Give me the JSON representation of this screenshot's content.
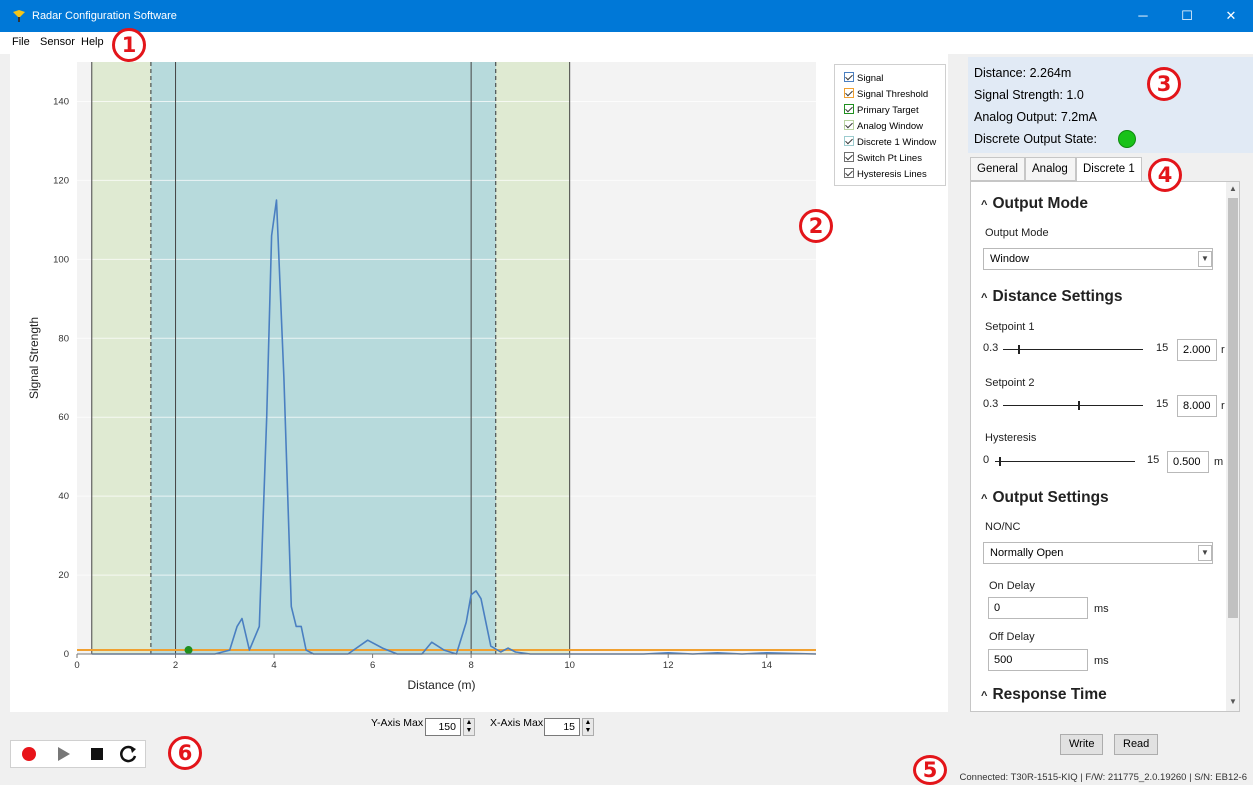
{
  "window": {
    "title": "Radar Configuration Software",
    "minimize": "─",
    "maximize": "☐",
    "close": "✕"
  },
  "menu": {
    "file": "File",
    "sensor": "Sensor",
    "help": "Help"
  },
  "badges": {
    "b1": "1",
    "b2": "2",
    "b3": "3",
    "b4": "4",
    "b5": "5",
    "b6": "6"
  },
  "legend": {
    "items": [
      "Signal",
      "Signal Threshold",
      "Primary Target",
      "Analog Window",
      "Discrete 1 Window",
      "Switch Pt Lines",
      "Hysteresis Lines"
    ]
  },
  "readout": {
    "distance": "Distance: 2.264m",
    "signal_strength": "Signal Strength:  1.0",
    "analog_output": "Analog Output:  7.2mA",
    "discrete_state_label": "Discrete Output State:"
  },
  "tabs": [
    "General",
    "Analog",
    "Discrete 1"
  ],
  "panel": {
    "output_mode_header": "Output Mode",
    "output_mode_label": "Output Mode",
    "output_mode_value": "Window",
    "distance_header": "Distance Settings",
    "setpoint1_label": "Setpoint 1",
    "setpoint1_min": "0.3",
    "setpoint1_max": "15",
    "setpoint1_value": "2.000",
    "setpoint1_unit": "r",
    "setpoint2_label": "Setpoint 2",
    "setpoint2_min": "0.3",
    "setpoint2_max": "15",
    "setpoint2_value": "8.000",
    "setpoint2_unit": "r",
    "hysteresis_label": "Hysteresis",
    "hysteresis_min": "0",
    "hysteresis_max": "15",
    "hysteresis_value": "0.500",
    "hysteresis_unit": "m",
    "output_settings_header": "Output Settings",
    "nonc_label": "NO/NC",
    "nonc_value": "Normally Open",
    "on_delay_label": "On Delay",
    "on_delay_value": "0",
    "on_delay_unit": "ms",
    "off_delay_label": "Off Delay",
    "off_delay_value": "500",
    "off_delay_unit": "ms",
    "response_header": "Response Time",
    "caret": "^"
  },
  "buttons": {
    "write": "Write",
    "read": "Read"
  },
  "axis_controls": {
    "y_label": "Y-Axis Max",
    "y_value": "150",
    "x_label": "X-Axis Max",
    "x_value": "15"
  },
  "status": "Connected: T30R-1515-KIQ | F/W: 211775_2.0.19260 | S/N: EB12-6",
  "colors": {
    "accent": "#0078d7",
    "analog_window": "#dfead2",
    "discrete_window": "#b7dadc",
    "signal": "#4a7fc1",
    "threshold": "#f0a030",
    "target": "#1f8f1f",
    "badge": "#e3151a"
  },
  "chart_data": {
    "type": "line",
    "xlabel": "Distance (m)",
    "ylabel": "Signal Strength",
    "xlim": [
      0,
      15
    ],
    "ylim": [
      0,
      150
    ],
    "x_ticks": [
      "0",
      "2",
      "4",
      "6",
      "8",
      "10",
      "12",
      "14"
    ],
    "y_ticks": [
      "0",
      "20",
      "40",
      "60",
      "80",
      "100",
      "120",
      "140"
    ],
    "analog_window": [
      0.3,
      10
    ],
    "discrete_window": [
      1.5,
      8.5
    ],
    "switch_points": [
      2,
      8
    ],
    "threshold": 1,
    "primary_target": {
      "x": 2.264,
      "y": 1.0
    },
    "series": [
      {
        "x": [
          0.3,
          2.8,
          3.1,
          3.25,
          3.35,
          3.5,
          3.7,
          3.85,
          3.95,
          4.05,
          4.2,
          4.35,
          4.45,
          4.55,
          4.65,
          4.8,
          5.5,
          5.9,
          6.2,
          6.5,
          7.0,
          7.2,
          7.45,
          7.7,
          7.9,
          8.0,
          8.1,
          8.2,
          8.4,
          8.6,
          8.75,
          8.9,
          9.2,
          11.5,
          12.0,
          12.5,
          13.0,
          13.5,
          14.0,
          15.0
        ],
        "y": [
          0,
          0,
          1,
          7,
          9,
          1,
          7,
          60,
          106,
          115,
          70,
          12,
          7,
          7,
          1,
          0,
          0,
          3.5,
          1.5,
          0,
          0,
          3,
          1,
          0,
          8,
          15,
          16,
          14,
          2,
          0.5,
          1.5,
          0.5,
          0,
          0,
          0.3,
          0,
          0.3,
          0,
          0.3,
          0
        ]
      }
    ]
  }
}
